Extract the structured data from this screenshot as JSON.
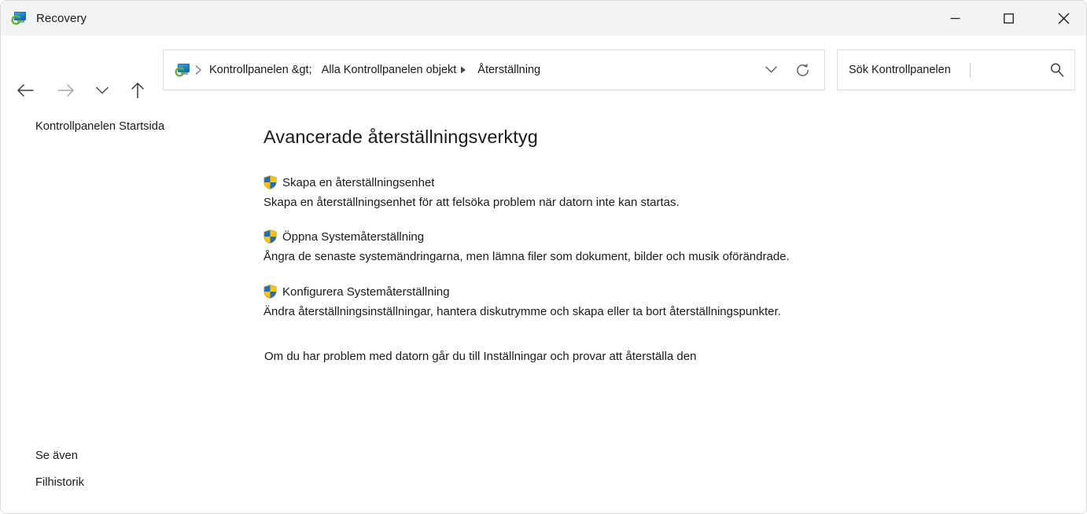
{
  "window": {
    "title": "Recovery",
    "app_icon": "recovery-monitor-icon",
    "controls": {
      "minimize": "minimize-icon",
      "maximize": "maximize-icon",
      "close": "close-icon"
    }
  },
  "navigation": {
    "back": "back-arrow-icon",
    "forward": "forward-arrow-icon",
    "recent": "chevron-down-icon",
    "up": "up-arrow-icon",
    "address": {
      "icon": "control-panel-icon",
      "breadcrumbs": [
        "Kontrollpanelen &gt;",
        "Alla Kontrollpanelen objekt",
        "Återställning"
      ],
      "dropdown": "chevron-down-icon",
      "refresh": "refresh-icon"
    },
    "search": {
      "value": "Sök Kontrollpanelen",
      "placeholder": "Sök Kontrollpanelen",
      "icon": "search-icon"
    }
  },
  "help": {
    "label": "?",
    "color": "#1b8fd6"
  },
  "sidebar": {
    "home_link": "Kontrollpanelen Startsida",
    "see_also_heading": "Se även",
    "see_also_items": [
      "Filhistorik"
    ]
  },
  "main": {
    "heading": "Avancerade återställningsverktyg",
    "tasks": [
      {
        "icon": "uac-shield-icon",
        "link": "Skapa en återställningsenhet",
        "description": "Skapa en återställningsenhet för att felsöka problem när datorn inte kan startas."
      },
      {
        "icon": "uac-shield-icon",
        "link": "Öppna Systemåterställning",
        "description": "Ångra de senaste systemändringarna, men lämna filer som dokument, bilder och musik oförändrade."
      },
      {
        "icon": "uac-shield-icon",
        "link": "Konfigurera Systemåterställning",
        "description": "Ändra återställningsinställningar, hantera diskutrymme och skapa eller ta bort återställningspunkter."
      }
    ],
    "footnote": "Om du har problem med datorn går du till Inställningar och provar att återställa den"
  },
  "colors": {
    "titlebar_bg": "#f3f3f3",
    "window_bg": "#ffffff",
    "text": "#1a1a1a",
    "border": "#dcdcdc",
    "help_blue": "#1b8fd6",
    "shield_blue": "#1b6ec2",
    "shield_yellow": "#ffc40a"
  }
}
